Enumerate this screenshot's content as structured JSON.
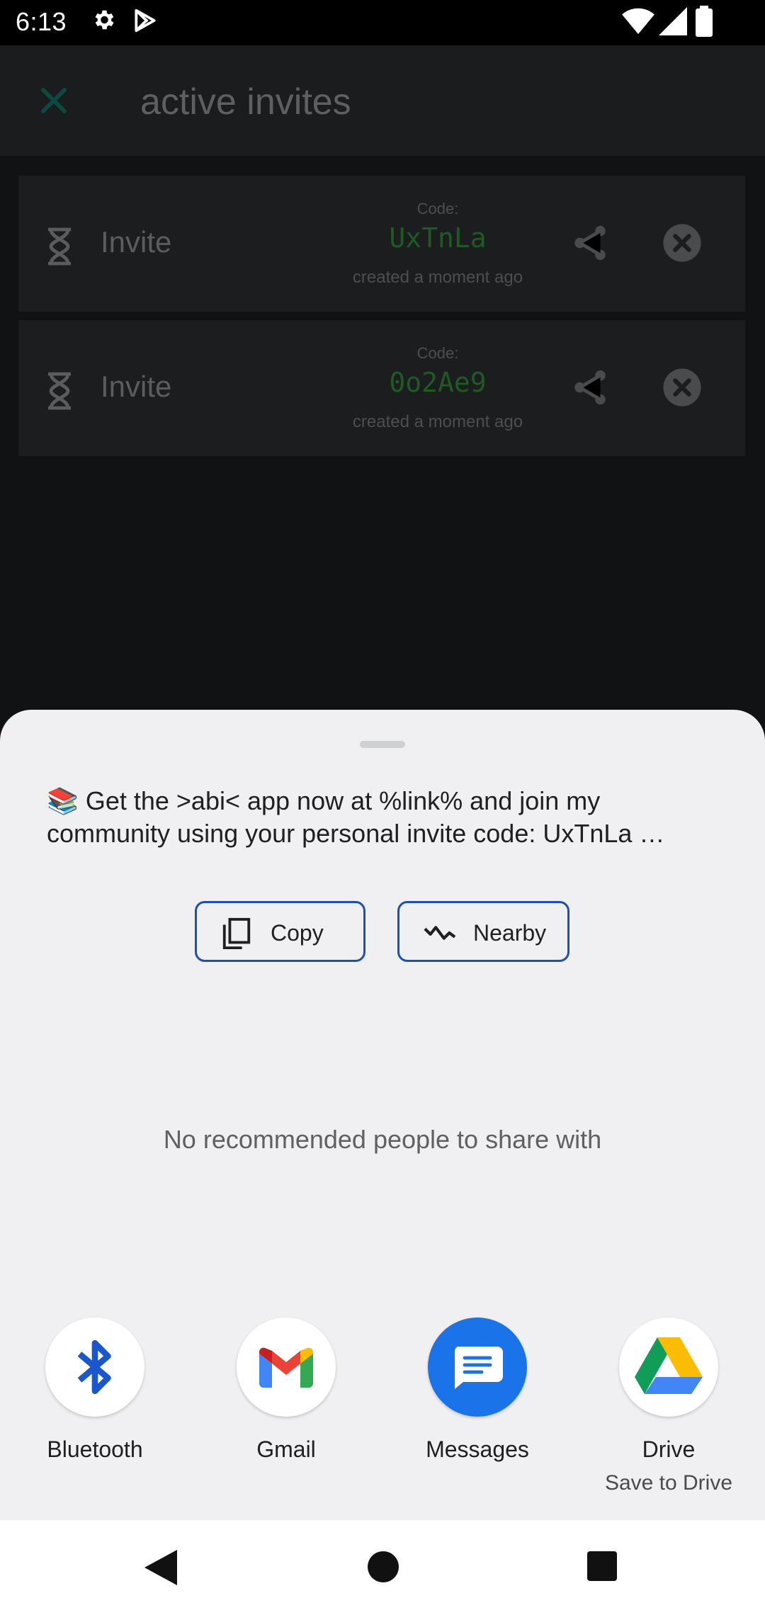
{
  "status_bar": {
    "time": "6:13",
    "icons": [
      "gear-icon",
      "play-store-icon",
      "wifi-icon",
      "signal-icon",
      "battery-icon"
    ]
  },
  "app_bar": {
    "title": "active invites",
    "close_icon": "close-icon",
    "accent": "#00897b"
  },
  "invites": [
    {
      "label": "Invite",
      "code_label": "Code:",
      "code": "UxTnLa",
      "created": "created a moment ago"
    },
    {
      "label": "Invite",
      "code_label": "Code:",
      "code": "0o2Ae9",
      "created": "created a moment ago"
    }
  ],
  "share_sheet": {
    "preview_text": "📚 Get the >abi< app now at %link% and join my community using your personal invite code: UxTnLa …",
    "actions": [
      {
        "label": "Copy",
        "icon": "copy-icon"
      },
      {
        "label": "Nearby",
        "icon": "nearby-icon"
      }
    ],
    "no_recommendations": "No recommended people to share with",
    "targets": [
      {
        "name": "Bluetooth",
        "icon": "bluetooth-icon"
      },
      {
        "name": "Gmail",
        "icon": "gmail-icon"
      },
      {
        "name": "Messages",
        "icon": "messages-icon"
      },
      {
        "name": "Drive",
        "sub": "Save to Drive",
        "icon": "drive-icon"
      }
    ],
    "accent": "#1f4fb3"
  },
  "nav_bar": {
    "icons": [
      "back-icon",
      "home-icon",
      "recents-icon"
    ]
  }
}
